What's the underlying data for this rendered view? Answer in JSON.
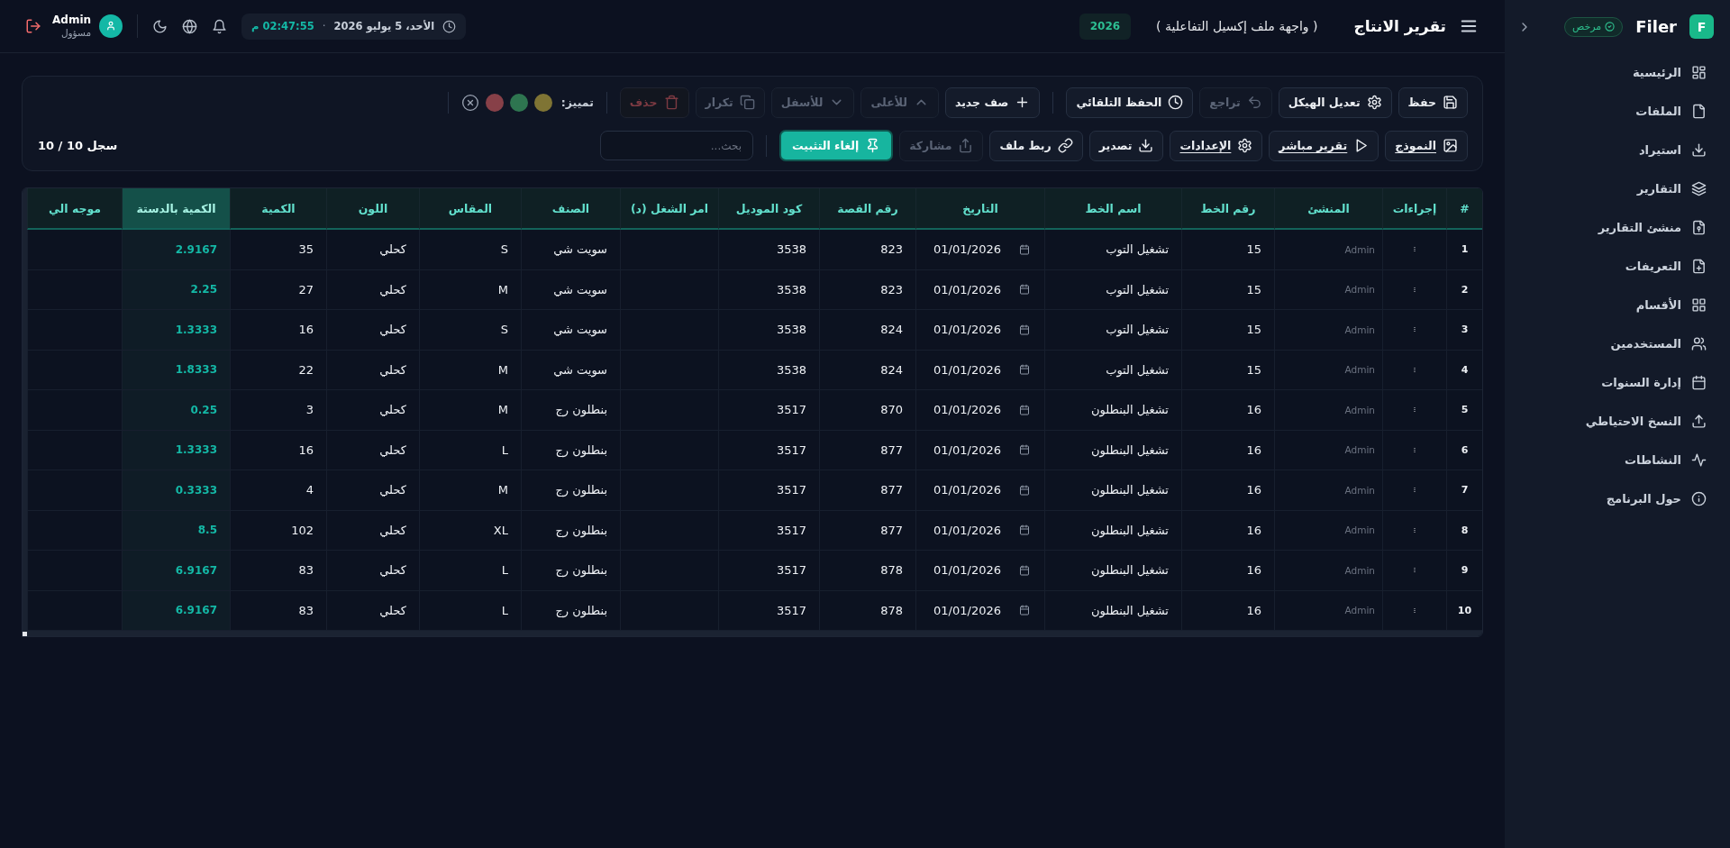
{
  "sidebar": {
    "logo_letter": "F",
    "app_name": "Filer",
    "license_badge": "مرخص",
    "items": [
      {
        "label": "الرئيسية",
        "selected": false
      },
      {
        "label": "الملفات",
        "selected": false
      },
      {
        "label": "استيراد",
        "selected": false
      },
      {
        "label": "التقارير",
        "selected": false
      },
      {
        "label": "منشئ التقارير",
        "selected": false
      },
      {
        "label": "التعريفات",
        "selected": false
      },
      {
        "label": "الأقسام",
        "selected": false
      },
      {
        "label": "المستخدمين",
        "selected": false
      },
      {
        "label": "إدارة السنوات",
        "selected": false
      },
      {
        "label": "النسخ الاحتياطي",
        "selected": false
      },
      {
        "label": "النشاطات",
        "selected": false
      },
      {
        "label": "حول البرنامج",
        "selected": false
      }
    ]
  },
  "topbar": {
    "title": "تقرير الانتاج",
    "subtitle": "( واجهة ملف إكسيل التفاعلية )",
    "year": "2026",
    "date": "الأحد، 5 يوليو 2026",
    "separator": "·",
    "time": "02:47:55 م",
    "user_name": "Admin",
    "user_role": "مسؤول"
  },
  "toolbar": {
    "file_actions": [
      {
        "label": "حفظ",
        "kind": "default",
        "disabled": false,
        "underlined": false
      },
      {
        "label": "تعديل الهيكل",
        "kind": "default",
        "disabled": false,
        "underlined": false
      },
      {
        "label": "تراجع",
        "kind": "default",
        "disabled": true,
        "underlined": false
      },
      {
        "label": "الحفظ التلقائي",
        "kind": "default",
        "disabled": false,
        "underlined": false
      }
    ],
    "row_actions": [
      {
        "label": "صف جديد",
        "kind": "default",
        "disabled": false,
        "underlined": false
      },
      {
        "label": "للأعلى",
        "kind": "default",
        "disabled": true,
        "underlined": false
      },
      {
        "label": "للأسفل",
        "kind": "default",
        "disabled": true,
        "underlined": false
      },
      {
        "label": "تكرار",
        "kind": "default",
        "disabled": true,
        "underlined": false
      },
      {
        "label": "حذف",
        "kind": "danger",
        "disabled": true,
        "underlined": false
      }
    ],
    "highlight": {
      "label": "تمييز:",
      "swatches": [
        {
          "color": "#7f7434"
        },
        {
          "color": "#2e7550"
        },
        {
          "color": "#874048"
        }
      ]
    },
    "view_actions": [
      {
        "label": "النموذج",
        "kind": "default",
        "disabled": false,
        "underlined": true
      },
      {
        "label": "تقرير مباشر",
        "kind": "default",
        "disabled": false,
        "underlined": true
      },
      {
        "label": "الإعدادات",
        "kind": "default",
        "disabled": false,
        "underlined": true
      },
      {
        "label": "تصدير",
        "kind": "default",
        "disabled": false,
        "underlined": false
      },
      {
        "label": "ربط ملف",
        "kind": "default",
        "disabled": false,
        "underlined": false
      },
      {
        "label": "مشاركة",
        "kind": "default",
        "disabled": true,
        "underlined": false
      },
      {
        "label": "إلغاء التثبيت",
        "kind": "primary",
        "disabled": false,
        "underlined": false
      }
    ],
    "search": {
      "placeholder": "بحث..."
    },
    "record_count": "10 / 10 سجل"
  },
  "table": {
    "columns": [
      {
        "label": "#",
        "kind": "index",
        "highlighted": false
      },
      {
        "label": "إجراءات",
        "kind": "actions",
        "highlighted": false
      },
      {
        "label": "المنشئ",
        "kind": "muted",
        "highlighted": false
      },
      {
        "label": "رقم الخط",
        "kind": "text",
        "highlighted": false
      },
      {
        "label": "اسم الخط",
        "kind": "text",
        "highlighted": false
      },
      {
        "label": "التاريخ",
        "kind": "date",
        "highlighted": false
      },
      {
        "label": "رقم القصة",
        "kind": "text",
        "highlighted": false
      },
      {
        "label": "كود الموديل",
        "kind": "text",
        "highlighted": false
      },
      {
        "label": "امر الشغل (د)",
        "kind": "text",
        "highlighted": false
      },
      {
        "label": "الصنف",
        "kind": "text",
        "highlighted": false
      },
      {
        "label": "المقاس",
        "kind": "text",
        "highlighted": false
      },
      {
        "label": "اللون",
        "kind": "text",
        "highlighted": false
      },
      {
        "label": "الكمية",
        "kind": "text",
        "highlighted": false
      },
      {
        "label": "الكمية بالدستة",
        "kind": "text",
        "highlighted": true
      },
      {
        "label": "موجه الي",
        "kind": "text",
        "highlighted": false
      }
    ],
    "rows": [
      {
        "number": "1",
        "creator": "Admin",
        "line_no": "15",
        "line_name": "تشغيل التوب",
        "date": "01/01/2026",
        "story_no": "823",
        "model_code": "3538",
        "item": "سويت شي",
        "size": "S",
        "fabric_color": "كحلي",
        "quantity": "35",
        "dozen_quantity": "2.9167"
      },
      {
        "number": "2",
        "creator": "Admin",
        "line_no": "15",
        "line_name": "تشغيل التوب",
        "date": "01/01/2026",
        "story_no": "823",
        "model_code": "3538",
        "item": "سويت شي",
        "size": "M",
        "fabric_color": "كحلي",
        "quantity": "27",
        "dozen_quantity": "2.25"
      },
      {
        "number": "3",
        "creator": "Admin",
        "line_no": "15",
        "line_name": "تشغيل التوب",
        "date": "01/01/2026",
        "story_no": "824",
        "model_code": "3538",
        "item": "سويت شي",
        "size": "S",
        "fabric_color": "كحلي",
        "quantity": "16",
        "dozen_quantity": "1.3333"
      },
      {
        "number": "4",
        "creator": "Admin",
        "line_no": "15",
        "line_name": "تشغيل التوب",
        "date": "01/01/2026",
        "story_no": "824",
        "model_code": "3538",
        "item": "سويت شي",
        "size": "M",
        "fabric_color": "كحلي",
        "quantity": "22",
        "dozen_quantity": "1.8333"
      },
      {
        "number": "5",
        "creator": "Admin",
        "line_no": "16",
        "line_name": "تشغيل البنطلون",
        "date": "01/01/2026",
        "story_no": "870",
        "model_code": "3517",
        "item": "بنطلون رج",
        "size": "M",
        "fabric_color": "كحلي",
        "quantity": "3",
        "dozen_quantity": "0.25"
      },
      {
        "number": "6",
        "creator": "Admin",
        "line_no": "16",
        "line_name": "تشغيل البنطلون",
        "date": "01/01/2026",
        "story_no": "877",
        "model_code": "3517",
        "item": "بنطلون رج",
        "size": "L",
        "fabric_color": "كحلي",
        "quantity": "16",
        "dozen_quantity": "1.3333"
      },
      {
        "number": "7",
        "creator": "Admin",
        "line_no": "16",
        "line_name": "تشغيل البنطلون",
        "date": "01/01/2026",
        "story_no": "877",
        "model_code": "3517",
        "item": "بنطلون رج",
        "size": "M",
        "fabric_color": "كحلي",
        "quantity": "4",
        "dozen_quantity": "0.3333"
      },
      {
        "number": "8",
        "creator": "Admin",
        "line_no": "16",
        "line_name": "تشغيل البنطلون",
        "date": "01/01/2026",
        "story_no": "877",
        "model_code": "3517",
        "item": "بنطلون رج",
        "size": "XL",
        "fabric_color": "كحلي",
        "quantity": "102",
        "dozen_quantity": "8.5"
      },
      {
        "number": "9",
        "creator": "Admin",
        "line_no": "16",
        "line_name": "تشغيل البنطلون",
        "date": "01/01/2026",
        "story_no": "878",
        "model_code": "3517",
        "item": "بنطلون رج",
        "size": "L",
        "fabric_color": "كحلي",
        "quantity": "83",
        "dozen_quantity": "6.9167"
      },
      {
        "number": "10",
        "creator": "Admin",
        "line_no": "16",
        "line_name": "تشغيل البنطلون",
        "date": "01/01/2026",
        "story_no": "878",
        "model_code": "3517",
        "item": "بنطلون رج",
        "size": "L",
        "fabric_color": "كحلي",
        "quantity": "83",
        "dozen_quantity": "6.9167"
      }
    ]
  }
}
